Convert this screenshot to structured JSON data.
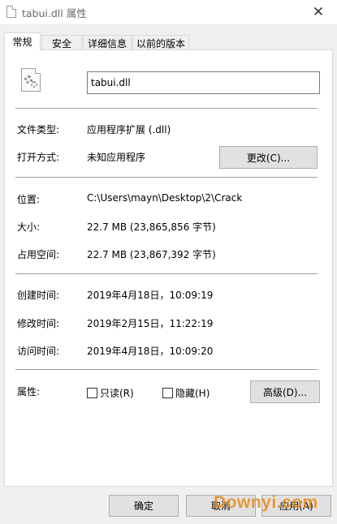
{
  "window": {
    "title": "tabui.dll 属性",
    "close_glyph": "✕"
  },
  "tabs": [
    {
      "label": "常规",
      "active": true
    },
    {
      "label": "安全",
      "active": false
    },
    {
      "label": "详细信息",
      "active": false
    },
    {
      "label": "以前的版本",
      "active": false
    }
  ],
  "general": {
    "file_name": "tabui.dll",
    "file_type_label": "文件类型:",
    "file_type_value": "应用程序扩展 (.dll)",
    "opens_with_label": "打开方式:",
    "opens_with_value": "未知应用程序",
    "change_button": "更改(C)...",
    "location_label": "位置:",
    "location_value": "C:\\Users\\mayn\\Desktop\\2\\Crack",
    "size_label": "大小:",
    "size_value": "22.7 MB (23,865,856 字节)",
    "size_on_disk_label": "占用空间:",
    "size_on_disk_value": "22.7 MB (23,867,392 字节)",
    "created_label": "创建时间:",
    "created_value": "2019年4月18日，10:09:19",
    "modified_label": "修改时间:",
    "modified_value": "2019年2月15日，11:22:19",
    "accessed_label": "访问时间:",
    "accessed_value": "2019年4月18日，10:09:20",
    "attributes_label": "属性:",
    "readonly_label": "只读(R)",
    "readonly_checked": false,
    "hidden_label": "隐藏(H)",
    "hidden_checked": false,
    "advanced_button": "高级(D)..."
  },
  "footer": {
    "ok_button": "确定",
    "cancel_button": "取消",
    "apply_button": "应用(A)"
  },
  "watermark": {
    "text": "Downyi.com",
    "color": "#e88c1a"
  }
}
